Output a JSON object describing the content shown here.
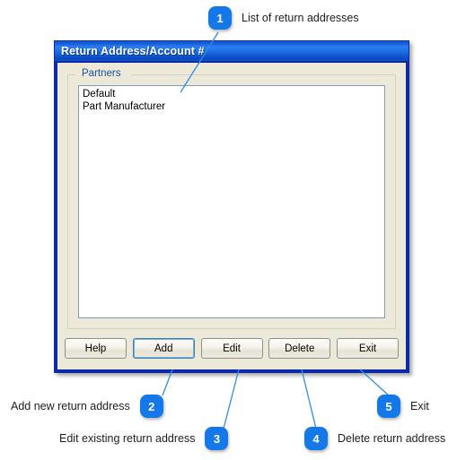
{
  "dialog": {
    "title": "Return Address/Account #",
    "groupbox_label": "Partners",
    "list_items": [
      "Default",
      "Part Manufacturer"
    ],
    "buttons": [
      {
        "label": "Help",
        "name": "help-button",
        "focused": false
      },
      {
        "label": "Add",
        "name": "add-button",
        "focused": true
      },
      {
        "label": "Edit",
        "name": "edit-button",
        "focused": false
      },
      {
        "label": "Delete",
        "name": "delete-button",
        "focused": false
      },
      {
        "label": "Exit",
        "name": "exit-button",
        "focused": false
      }
    ]
  },
  "callouts": [
    {
      "number": "1",
      "text": "List of return addresses"
    },
    {
      "number": "2",
      "text": "Add new return address"
    },
    {
      "number": "3",
      "text": "Edit existing return address"
    },
    {
      "number": "4",
      "text": "Delete return address"
    },
    {
      "number": "5",
      "text": "Exit"
    }
  ],
  "colors": {
    "badge_blue": "#1478e8",
    "titlebar_blue": "#0a2aa8",
    "dialog_face": "#ece9d8",
    "groupbox_label_blue": "#1b4fa0",
    "leader_line": "#2f8fe0"
  }
}
